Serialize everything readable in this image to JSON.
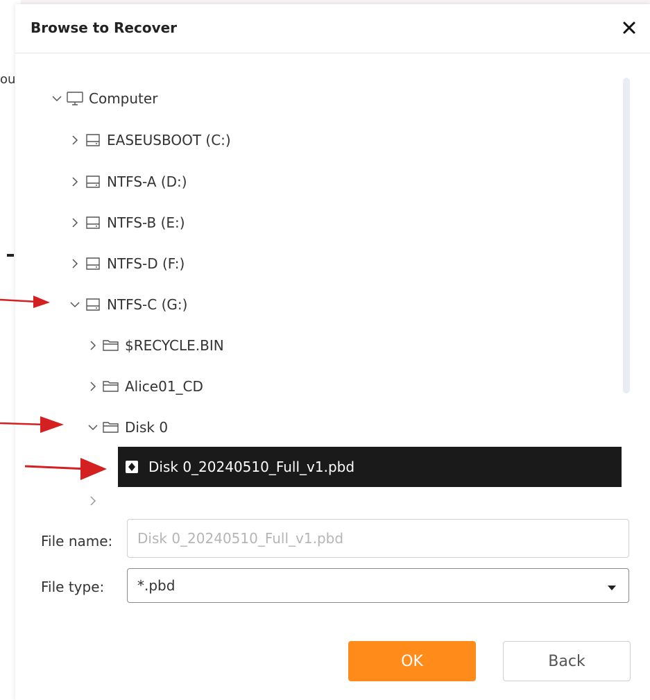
{
  "background": {
    "partial_text": "ou"
  },
  "dialog": {
    "title": "Browse to Recover",
    "close_icon": "close-icon"
  },
  "tree": {
    "items": [
      {
        "label": "Computer",
        "icon": "computer-icon",
        "expanded": true
      },
      {
        "label": "EASEUSBOOT (C:)",
        "icon": "drive-icon",
        "expanded": false
      },
      {
        "label": "NTFS-A (D:)",
        "icon": "drive-icon",
        "expanded": false
      },
      {
        "label": "NTFS-B (E:)",
        "icon": "drive-icon",
        "expanded": false
      },
      {
        "label": "NTFS-D (F:)",
        "icon": "drive-icon",
        "expanded": false
      },
      {
        "label": "NTFS-C (G:)",
        "icon": "drive-icon",
        "expanded": true
      },
      {
        "label": "$RECYCLE.BIN",
        "icon": "folder-icon",
        "expanded": false
      },
      {
        "label": "Alice01_CD",
        "icon": "folder-icon",
        "expanded": false
      },
      {
        "label": "Disk 0",
        "icon": "folder-icon",
        "expanded": true
      },
      {
        "label": "Disk 0_20240510_Full_v1.pbd",
        "icon": "backup-file-icon",
        "selected": true
      }
    ]
  },
  "form": {
    "file_name_label": "File name:",
    "file_name_placeholder": "Disk 0_20240510_Full_v1.pbd",
    "file_type_label": "File type:",
    "file_type_value": "*.pbd"
  },
  "buttons": {
    "ok": "OK",
    "back": "Back"
  },
  "colors": {
    "ok_button": "#ff8c1a",
    "selection": "#1a1a1a",
    "annotation_arrow": "#d42020"
  }
}
